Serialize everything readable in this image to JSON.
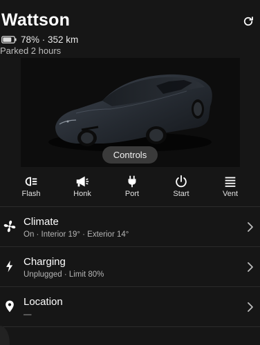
{
  "vehicle": {
    "name": "Wattson",
    "battery": "78% · 352 km",
    "battery_level": 0.78,
    "status": "Parked 2 hours"
  },
  "car_image": {
    "controls_label": "Controls"
  },
  "actions": [
    {
      "label": "Flash",
      "icon": "headlight-icon"
    },
    {
      "label": "Honk",
      "icon": "horn-icon"
    },
    {
      "label": "Port",
      "icon": "charge-plug-icon"
    },
    {
      "label": "Start",
      "icon": "power-icon"
    },
    {
      "label": "Vent",
      "icon": "vent-icon"
    }
  ],
  "rows": [
    {
      "title": "Climate",
      "subtitle": "On · Interior 19° · Exterior 14°",
      "icon": "fan-icon"
    },
    {
      "title": "Charging",
      "subtitle": "Unplugged · Limit 80%",
      "icon": "lightning-icon"
    },
    {
      "title": "Location",
      "subtitle": "—",
      "icon": "location-pin-icon"
    }
  ],
  "colors": {
    "background": "#161616",
    "panel": "#0d0d0d",
    "text": "#ffffff",
    "subtext": "#b5b5b5",
    "divider": "#2b2b2b"
  }
}
